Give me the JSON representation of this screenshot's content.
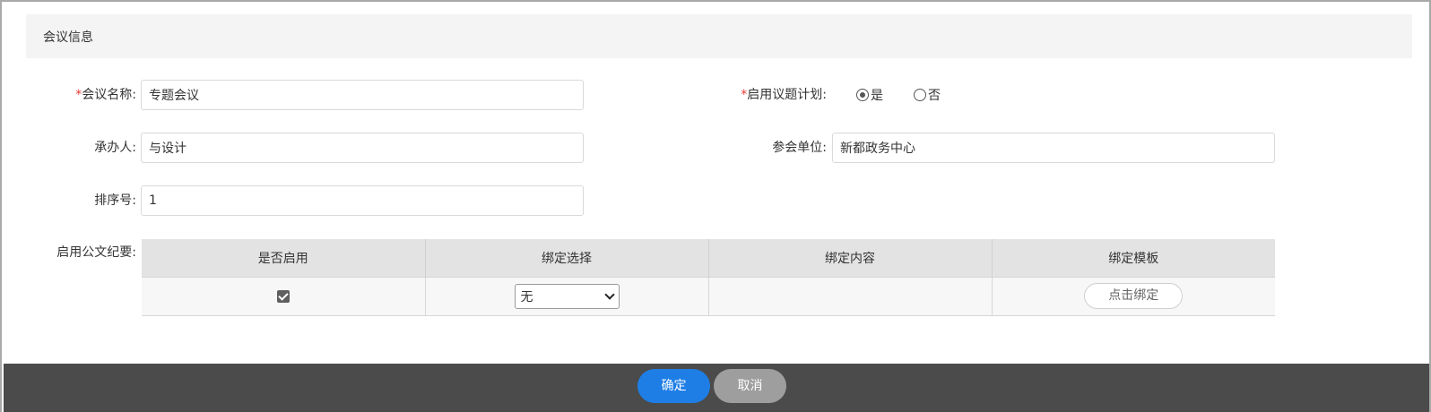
{
  "section": {
    "title": "会议信息"
  },
  "form": {
    "meeting_name": {
      "label": "会议名称:",
      "required_mark": "*",
      "value": "专题会议"
    },
    "enable_agenda": {
      "label": "启用议题计划:",
      "required_mark": "*",
      "options": [
        {
          "label": "是",
          "checked": true
        },
        {
          "label": "否",
          "checked": false
        }
      ]
    },
    "organizer": {
      "label": "承办人:",
      "value": "与设计"
    },
    "attending_unit": {
      "label": "参会单位:",
      "value": "新都政务中心"
    },
    "sort_number": {
      "label": "排序号:",
      "value": "1"
    },
    "official_doc": {
      "label": "启用公文纪要:"
    }
  },
  "table": {
    "headers": [
      "是否启用",
      "绑定选择",
      "绑定内容",
      "绑定模板"
    ],
    "row": {
      "enabled": true,
      "binding_select": "无",
      "binding_content": "",
      "bind_button": "点击绑定"
    }
  },
  "footer": {
    "confirm": "确定",
    "cancel": "取消"
  },
  "colors": {
    "primary": "#1e7ee6",
    "cancel": "#9e9e9e",
    "footer_bg": "#4b4b4b",
    "required": "#e53935"
  }
}
